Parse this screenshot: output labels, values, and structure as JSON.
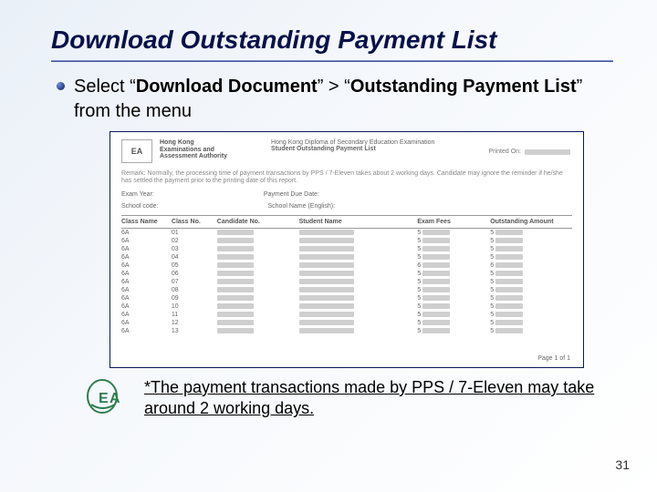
{
  "title": "Download Outstanding Payment List",
  "bullet": {
    "prefix": "Select “",
    "bold1": "Download Document",
    "mid": "” > “",
    "bold2": "Outstanding Payment List",
    "suffix": "” from the menu"
  },
  "doc": {
    "org_line1": "Hong Kong",
    "org_line2": "Examinations and",
    "org_line3": "Assessment Authority",
    "exam_name": "Hong Kong Diploma of Secondary Education Examination",
    "report_name": "Student Outstanding Payment List",
    "printed_label": "Printed On:",
    "remark": "Remark: Normally, the processing time of payment transactions by PPS / 7-Eleven takes about 2 working days. Candidate may ignore the reminder if he/she has settled the payment prior to the printing date of this report.",
    "meta": {
      "exam_year_label": "Exam Year:",
      "school_code_label": "School code:",
      "payment_due_label": "Payment Due Date:",
      "school_name_en_label": "School Name (English):"
    },
    "columns": {
      "class_name": "Class Name",
      "class_no": "Class No.",
      "candidate_no": "Candidate No.",
      "student_name": "Student Name",
      "exam_fees": "Exam Fees",
      "outstanding": "Outstanding Amount"
    },
    "rows": [
      {
        "class": "6A",
        "no": "01",
        "fees": "5",
        "out": "5"
      },
      {
        "class": "6A",
        "no": "02",
        "fees": "5",
        "out": "5"
      },
      {
        "class": "6A",
        "no": "03",
        "fees": "5",
        "out": "5"
      },
      {
        "class": "6A",
        "no": "04",
        "fees": "5",
        "out": "5"
      },
      {
        "class": "6A",
        "no": "05",
        "fees": "6",
        "out": "6"
      },
      {
        "class": "6A",
        "no": "06",
        "fees": "5",
        "out": "5"
      },
      {
        "class": "6A",
        "no": "07",
        "fees": "5",
        "out": "5"
      },
      {
        "class": "6A",
        "no": "08",
        "fees": "5",
        "out": "5"
      },
      {
        "class": "6A",
        "no": "09",
        "fees": "5",
        "out": "5"
      },
      {
        "class": "6A",
        "no": "10",
        "fees": "5",
        "out": "5"
      },
      {
        "class": "6A",
        "no": "11",
        "fees": "5",
        "out": "5"
      },
      {
        "class": "6A",
        "no": "12",
        "fees": "5",
        "out": "5"
      },
      {
        "class": "6A",
        "no": "13",
        "fees": "5",
        "out": "5"
      }
    ],
    "page_of": "Page 1 of 1"
  },
  "footnote": "*The payment transactions made by PPS / 7-Eleven may take around 2 working days.",
  "page_number": "31",
  "logo_text": "EA"
}
